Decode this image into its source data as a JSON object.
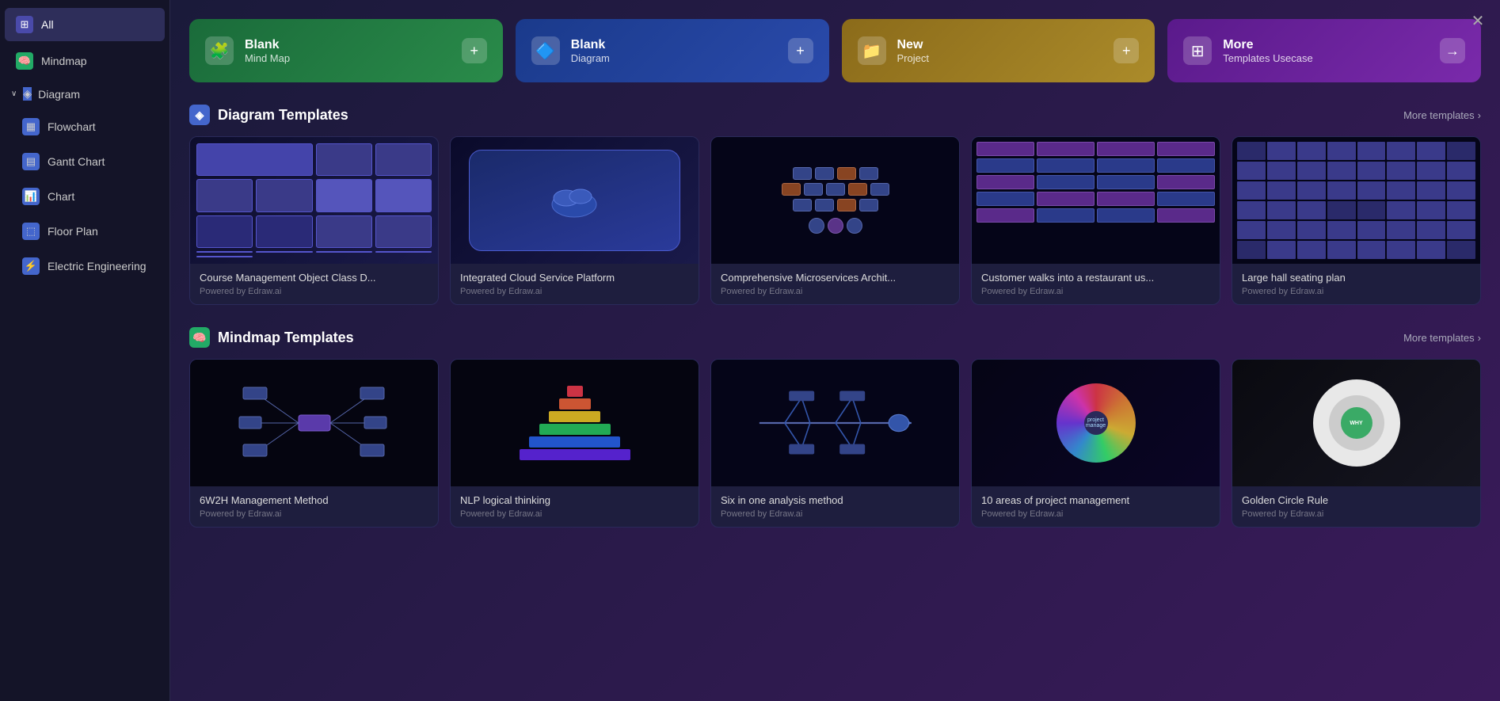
{
  "sidebar": {
    "items": [
      {
        "id": "all",
        "label": "All",
        "icon": "grid",
        "active": true
      },
      {
        "id": "mindmap",
        "label": "Mindmap",
        "icon": "mind"
      },
      {
        "id": "diagram",
        "label": "Diagram",
        "icon": "diagram",
        "expandable": true,
        "expanded": true
      },
      {
        "id": "flowchart",
        "label": "Flowchart",
        "icon": "flow",
        "sub": true
      },
      {
        "id": "gantt",
        "label": "Gantt Chart",
        "icon": "gantt",
        "sub": true
      },
      {
        "id": "chart",
        "label": "Chart",
        "icon": "chart",
        "sub": true
      },
      {
        "id": "floor",
        "label": "Floor Plan",
        "icon": "floor",
        "sub": true
      },
      {
        "id": "electric",
        "label": "Electric Engineering",
        "icon": "elec",
        "sub": true
      }
    ]
  },
  "quickCards": [
    {
      "id": "blank-mindmap",
      "title": "Blank",
      "subtitle": "Mind Map",
      "icon": "🧩",
      "color": "green",
      "action": "+"
    },
    {
      "id": "blank-diagram",
      "title": "Blank",
      "subtitle": "Diagram",
      "icon": "🔷",
      "color": "blue",
      "action": "+"
    },
    {
      "id": "new-project",
      "title": "New",
      "subtitle": "Project",
      "icon": "📁",
      "color": "gold",
      "action": "+"
    },
    {
      "id": "more-templates-usecase",
      "title": "More",
      "subtitle": "Templates Usecase",
      "icon": "⊞",
      "color": "purple",
      "action": "→"
    }
  ],
  "diagramSection": {
    "title": "Diagram Templates",
    "moreLabel": "More templates",
    "templates": [
      {
        "id": "course-mgmt",
        "name": "Course Management Object Class D...",
        "powered": "Powered by Edraw.ai",
        "thumb": "class"
      },
      {
        "id": "cloud-service",
        "name": "Integrated Cloud Service Platform",
        "powered": "Powered by Edraw.ai",
        "thumb": "cloud"
      },
      {
        "id": "microservices",
        "name": "Comprehensive Microservices Archit...",
        "powered": "Powered by Edraw.ai",
        "thumb": "micro"
      },
      {
        "id": "customer-walks",
        "name": "Customer walks into a restaurant us...",
        "powered": "Powered by Edraw.ai",
        "thumb": "customer"
      },
      {
        "id": "large-hall",
        "name": "Large hall seating plan",
        "powered": "Powered by Edraw.ai",
        "thumb": "seating"
      }
    ]
  },
  "mindmapSection": {
    "title": "Mindmap Templates",
    "moreLabel": "More templates",
    "templates": [
      {
        "id": "6w2h",
        "name": "6W2H Management Method",
        "powered": "Powered by Edraw.ai",
        "thumb": "6w2h"
      },
      {
        "id": "nlp",
        "name": "NLP logical thinking",
        "powered": "Powered by Edraw.ai",
        "thumb": "nlp"
      },
      {
        "id": "six-analysis",
        "name": "Six in one analysis method",
        "powered": "Powered by Edraw.ai",
        "thumb": "six"
      },
      {
        "id": "ten-areas",
        "name": "10 areas of project management",
        "powered": "Powered by Edraw.ai",
        "thumb": "wheel"
      },
      {
        "id": "golden-circle",
        "name": "Golden Circle Rule",
        "powered": "Powered by Edraw.ai",
        "thumb": "golden"
      }
    ]
  },
  "icons": {
    "grid": "⊞",
    "close": "✕",
    "chevron_right": "›",
    "chevron_down": "∨",
    "plus": "+",
    "arrow_right": "→"
  }
}
